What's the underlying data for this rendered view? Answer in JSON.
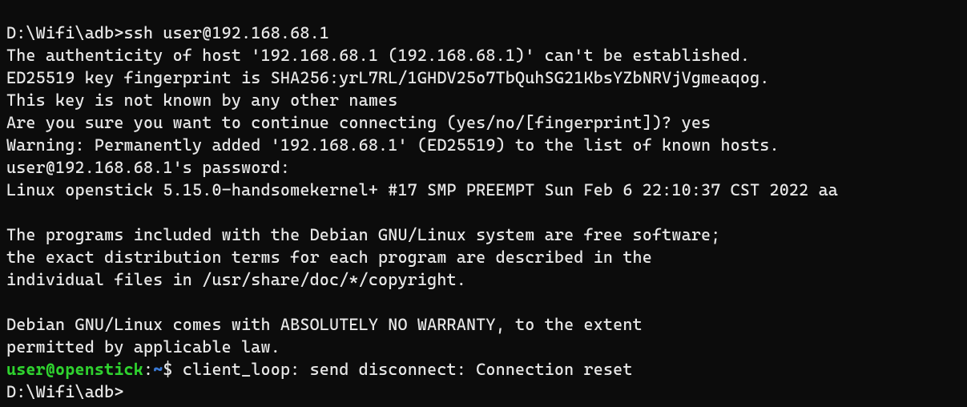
{
  "lines": {
    "l01_prompt": "D:\\Wifi\\adb>",
    "l01_cmd": "ssh user@192.168.68.1",
    "l02": "The authenticity of host '192.168.68.1 (192.168.68.1)' can't be established.",
    "l03": "ED25519 key fingerprint is SHA256:yrL7RL/1GHDV25o7TbQuhSG21KbsYZbNRVjVgmeaqog.",
    "l04": "This key is not known by any other names",
    "l05": "Are you sure you want to continue connecting (yes/no/[fingerprint])? yes",
    "l06": "Warning: Permanently added '192.168.68.1' (ED25519) to the list of known hosts.",
    "l07": "user@192.168.68.1's password:",
    "l08": "Linux openstick 5.15.0-handsomekernel+ #17 SMP PREEMPT Sun Feb 6 22:10:37 CST 2022 aa",
    "l09": "",
    "l10": "The programs included with the Debian GNU/Linux system are free software;",
    "l11": "the exact distribution terms for each program are described in the",
    "l12": "individual files in /usr/share/doc/*/copyright.",
    "l13": "",
    "l14": "Debian GNU/Linux comes with ABSOLUTELY NO WARRANTY, to the extent",
    "l15": "permitted by applicable law.",
    "l16_userhost": "user@openstick",
    "l16_colon": ":",
    "l16_path": "~",
    "l16_dollar": "$ ",
    "l16_msg": "client_loop: send disconnect: Connection reset",
    "l17_prompt": "D:\\Wifi\\adb>"
  }
}
